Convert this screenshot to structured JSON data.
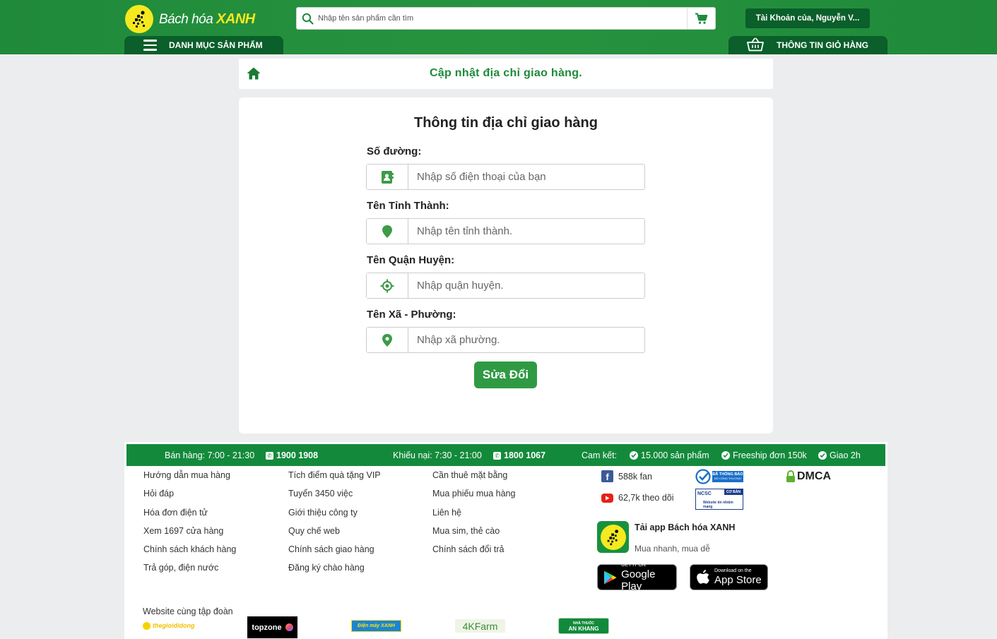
{
  "header": {
    "logo_text_1": "Bách hóa",
    "logo_text_2": "XANH",
    "search_placeholder": "Nhập tên sản phẩm cần tìm",
    "account_label": "Tài Khoản của, Nguyễn V...",
    "menu_label": "DANH MỤC SẢN PHẨM",
    "cart_info_label": "THÔNG TIN GIỎ HÀNG"
  },
  "notice": {
    "text": "Cập nhật địa chỉ giao hàng."
  },
  "form": {
    "title": "Thông tin địa chỉ giao hàng",
    "fields": [
      {
        "label": "Số đường:",
        "placeholder": "Nhập số điện thoại của bạn",
        "icon": "contact-card-icon"
      },
      {
        "label": "Tên Tỉnh Thành:",
        "placeholder": "Nhập tên tỉnh thành.",
        "icon": "map-pin-icon"
      },
      {
        "label": "Tên Quận Huyện:",
        "placeholder": "Nhập quận huyện.",
        "icon": "crosshair-icon"
      },
      {
        "label": "Tên Xã - Phường:",
        "placeholder": "Nhập xã phường.",
        "icon": "location-pin-icon"
      }
    ],
    "submit_label": "Sửa Đổi"
  },
  "footer": {
    "bar": {
      "sales_hours": "Bán hàng: 7:00 - 21:30",
      "sales_phone": "1900 1908",
      "complaint_hours": "Khiếu nại: 7:30 - 21:00",
      "complaint_phone": "1800 1067",
      "commit_label": "Cam kết:",
      "commit_1": "15.000 sản phẩm",
      "commit_2": "Freeship đơn 150k",
      "commit_3": "Giao 2h"
    },
    "col1": [
      "Hướng dẫn mua hàng",
      "Hỏi đáp",
      "Hóa đơn điện tử",
      "Xem 1697 cửa hàng",
      "Chính sách khách hàng",
      "Trả góp, điện nước"
    ],
    "col2": [
      "Tích điểm quà tặng VIP",
      "Tuyển 3450 việc",
      "Giới thiệu công ty",
      "Quy chế web",
      "Chính sách giao hàng",
      "Đăng ký chào hàng"
    ],
    "col3": [
      "Cần thuê mặt bằng",
      "Mua phiếu mua hàng",
      "Liên hệ",
      "Mua sim, thẻ cào",
      "Chính sách đổi trả"
    ],
    "facebook_fans": "588k fan",
    "youtube_followers": "62,7k theo dõi",
    "bct_badge_text": "ĐÃ THÔNG BÁO",
    "bct_badge_sub": "BỘ CÔNG THƯƠNG",
    "ncsc_text": "NCSC",
    "ncsc_sub": "Website tín nhiệm mạng",
    "ncsc_corner": "CƠ BẢN",
    "dmca": "DMCA",
    "app_title": "Tải app Bách hóa XANH",
    "app_sub": "Mua nhanh, mua dễ",
    "google_small": "GET IT ON",
    "google_big": "Google Play",
    "apple_small": "Download on the",
    "apple_big": "App Store",
    "group_title": "Website cùng tập đoàn",
    "brands": {
      "tgdd": "thegioididong",
      "topzone": "topzone",
      "dmx": "Điện máy XANH",
      "farm": "4KFarm",
      "pharmacy": "AN KHANG",
      "pharmacy_top": "NHÀ THUỐC"
    }
  }
}
